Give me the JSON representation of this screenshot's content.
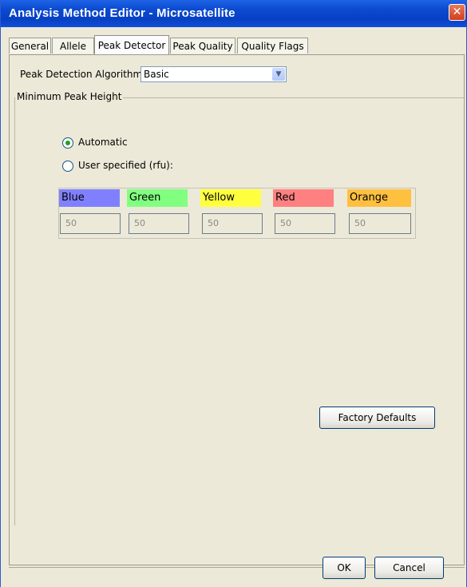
{
  "window": {
    "title": "Analysis Method Editor - Microsatellite",
    "close_glyph": "✕"
  },
  "tabs": [
    {
      "label": "General"
    },
    {
      "label": "Allele"
    },
    {
      "label": "Peak Detector",
      "active": true
    },
    {
      "label": "Peak Quality"
    },
    {
      "label": "Quality Flags"
    }
  ],
  "algorithm": {
    "label": "Peak Detection Algorithm:",
    "value": "Basic",
    "arrow_icon": "chevron-down-icon"
  },
  "min_peak_height": {
    "legend": "Minimum Peak Height",
    "options": [
      {
        "label": "Automatic",
        "selected": true
      },
      {
        "label": "User specified (rfu):",
        "selected": false
      }
    ],
    "channels": [
      {
        "name": "Blue",
        "color": "#8080FF",
        "value": "50"
      },
      {
        "name": "Green",
        "color": "#80FF80",
        "value": "50"
      },
      {
        "name": "Yellow",
        "color": "#FFFF40",
        "value": "50"
      },
      {
        "name": "Red",
        "color": "#FF8080",
        "value": "50"
      },
      {
        "name": "Orange",
        "color": "#FFC040",
        "value": "50"
      }
    ]
  },
  "buttons": {
    "factory_defaults": "Factory Defaults",
    "ok": "OK",
    "cancel": "Cancel"
  }
}
